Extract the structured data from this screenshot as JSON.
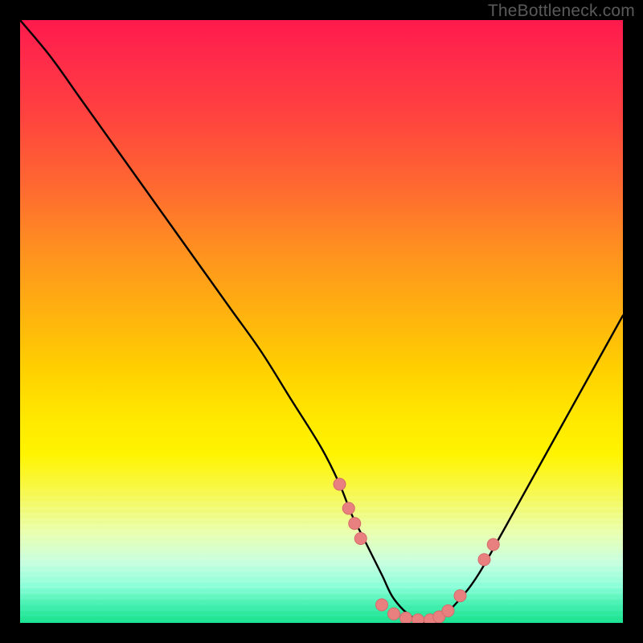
{
  "watermark": "TheBottleneck.com",
  "chart_data": {
    "type": "line",
    "title": "",
    "xlabel": "",
    "ylabel": "",
    "xlim": [
      0,
      100
    ],
    "ylim": [
      0,
      100
    ],
    "note": "Bottleneck curve over a vertical red-to-green gradient. Curve drops from top-left, reaches a minimum (≈0) around x≈62–70, then rises toward the right edge. Salmon dots mark sample points near the trough and on the slopes adjacent to it.",
    "series": [
      {
        "name": "bottleneck-curve",
        "x": [
          0,
          5,
          10,
          15,
          20,
          25,
          30,
          35,
          40,
          45,
          50,
          53,
          55,
          57,
          60,
          62,
          65,
          68,
          70,
          73,
          76,
          80,
          85,
          90,
          95,
          100
        ],
        "values": [
          100,
          94,
          87,
          80,
          73,
          66,
          59,
          52,
          45,
          37,
          29,
          23,
          18,
          14,
          8,
          4,
          1,
          0,
          1,
          4,
          8,
          15,
          24,
          33,
          42,
          51
        ]
      }
    ],
    "markers": [
      {
        "x": 53.0,
        "y": 23.0
      },
      {
        "x": 54.5,
        "y": 19.0
      },
      {
        "x": 55.5,
        "y": 16.5
      },
      {
        "x": 56.5,
        "y": 14.0
      },
      {
        "x": 60.0,
        "y": 3.0
      },
      {
        "x": 62.0,
        "y": 1.5
      },
      {
        "x": 64.0,
        "y": 0.8
      },
      {
        "x": 66.0,
        "y": 0.5
      },
      {
        "x": 68.0,
        "y": 0.5
      },
      {
        "x": 69.5,
        "y": 1.0
      },
      {
        "x": 71.0,
        "y": 2.0
      },
      {
        "x": 73.0,
        "y": 4.5
      },
      {
        "x": 77.0,
        "y": 10.5
      },
      {
        "x": 78.5,
        "y": 13.0
      }
    ],
    "colors": {
      "curve": "#000000",
      "marker_fill": "#e98080",
      "marker_stroke": "#d46a6a"
    }
  }
}
